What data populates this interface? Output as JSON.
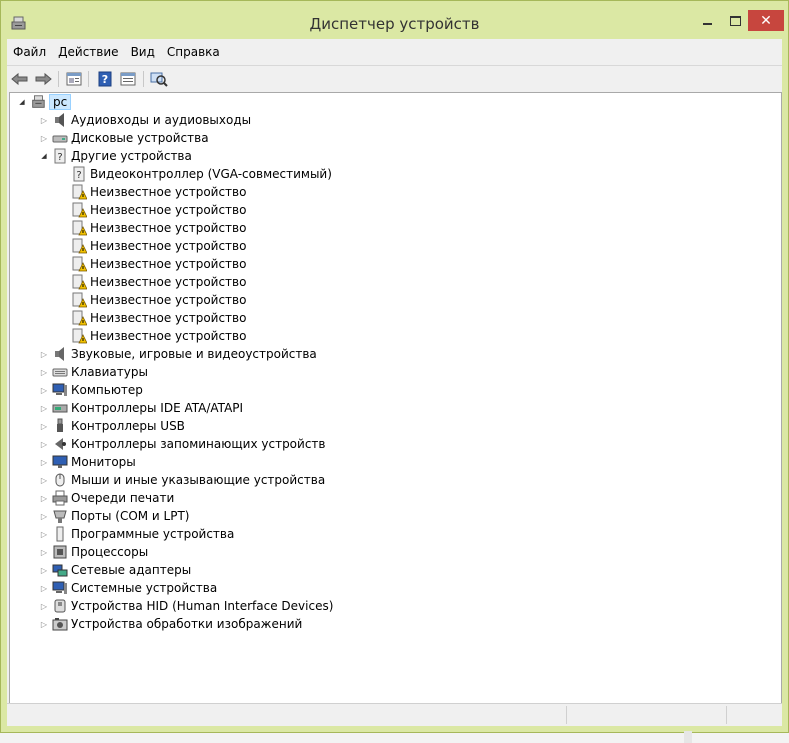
{
  "window": {
    "title": "Диспетчер устройств",
    "close_glyph": "✕"
  },
  "menu": [
    "Файл",
    "Действие",
    "Вид",
    "Справка"
  ],
  "toolbar": {
    "icons": [
      "back-arrow-icon",
      "forward-arrow-icon",
      "properties-icon",
      "help-icon",
      "device-view-icon",
      "scan-hardware-icon"
    ]
  },
  "tree": {
    "root": "pc",
    "categories": [
      "Аудиовходы и аудиовыходы",
      "Дисковые устройства",
      "Другие устройства",
      "Звуковые, игровые и видеоустройства",
      "Клавиатуры",
      "Компьютер",
      "Контроллеры IDE ATA/ATAPI",
      "Контроллеры USB",
      "Контроллеры запоминающих устройств",
      "Мониторы",
      "Мыши и иные указывающие устройства",
      "Очереди печати",
      "Порты (COM и LPT)",
      "Программные устройства",
      "Процессоры",
      "Сетевые адаптеры",
      "Системные устройства",
      "Устройства HID (Human Interface Devices)",
      "Устройства обработки изображений"
    ],
    "expanded_category": "Другие устройства",
    "other_devices": [
      "Видеоконтроллер (VGA-совместимый)",
      "Неизвестное устройство",
      "Неизвестное устройство",
      "Неизвестное устройство",
      "Неизвестное устройство",
      "Неизвестное устройство",
      "Неизвестное устройство",
      "Неизвестное устройство",
      "Неизвестное устройство",
      "Неизвестное устройство"
    ]
  },
  "colors": {
    "titlebar": "#dbe8a4",
    "close": "#c7463e",
    "selection": "#cce8ff",
    "warning": "#f2c200"
  }
}
